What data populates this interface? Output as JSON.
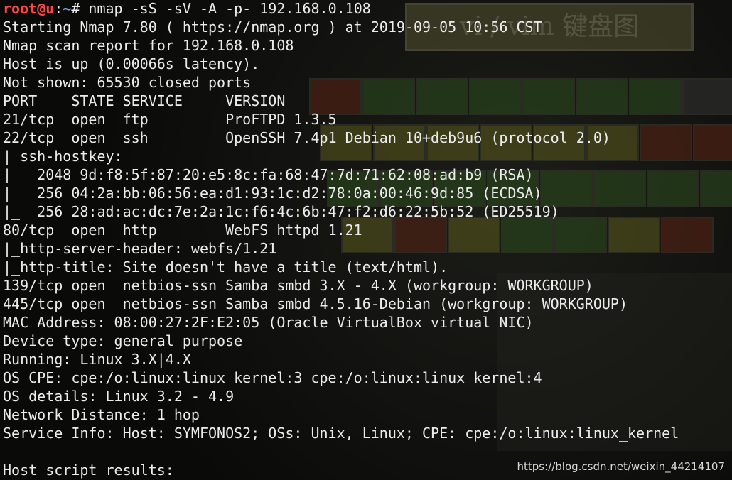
{
  "prompt": {
    "user_host": "root@u",
    "separator": ":",
    "path": "~",
    "symbol": "#",
    "command": " nmap -sS -sV -A -p- 192.168.0.108"
  },
  "output_lines": [
    "Starting Nmap 7.80 ( https://nmap.org ) at 2019-09-05 10:56 CST",
    "Nmap scan report for 192.168.0.108",
    "Host is up (0.00066s latency).",
    "Not shown: 65530 closed ports",
    "PORT    STATE SERVICE     VERSION",
    "21/tcp  open  ftp         ProFTPD 1.3.5",
    "22/tcp  open  ssh         OpenSSH 7.4p1 Debian 10+deb9u6 (protocol 2.0)",
    "| ssh-hostkey:",
    "|   2048 9d:f8:5f:87:20:e5:8c:fa:68:47:7d:71:62:08:ad:b9 (RSA)",
    "|   256 04:2a:bb:06:56:ea:d1:93:1c:d2:78:0a:00:46:9d:85 (ECDSA)",
    "|_  256 28:ad:ac:dc:7e:2a:1c:f6:4c:6b:47:f2:d6:22:5b:52 (ED25519)",
    "80/tcp  open  http        WebFS httpd 1.21",
    "|_http-server-header: webfs/1.21",
    "|_http-title: Site doesn't have a title (text/html).",
    "139/tcp open  netbios-ssn Samba smbd 3.X - 4.X (workgroup: WORKGROUP)",
    "445/tcp open  netbios-ssn Samba smbd 4.5.16-Debian (workgroup: WORKGROUP)",
    "MAC Address: 08:00:27:2F:E2:05 (Oracle VirtualBox virtual NIC)",
    "Device type: general purpose",
    "Running: Linux 3.X|4.X",
    "OS CPE: cpe:/o:linux:linux_kernel:3 cpe:/o:linux:linux_kernel:4",
    "OS details: Linux 3.2 - 4.9",
    "Network Distance: 1 hop",
    "Service Info: Host: SYMFONOS2; OSs: Unix, Linux; CPE: cpe:/o:linux:linux_kernel",
    "",
    "Host script results:"
  ],
  "wallpaper": {
    "title": "vi / vim 键盘图"
  },
  "watermark": "https://blog.csdn.net/weixin_44214107",
  "colors": {
    "prompt_user": "#ff4545",
    "prompt_path": "#8fa8e8",
    "text": "#ececec",
    "background": "#0b0c0a"
  }
}
